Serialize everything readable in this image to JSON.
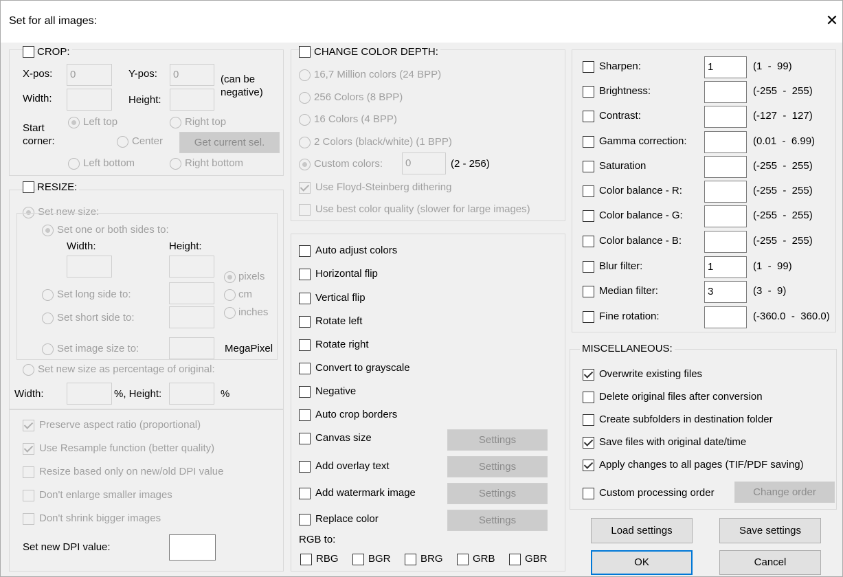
{
  "window": {
    "title": "Set for all images:",
    "close_symbol": "✕"
  },
  "crop": {
    "title": "CROP:",
    "xpos_label": "X-pos:",
    "xpos_value": "0",
    "ypos_label": "Y-pos:",
    "ypos_value": "0",
    "note": "(can be\nnegative)",
    "width_label": "Width:",
    "height_label": "Height:",
    "start_label": "Start\ncorner:",
    "left_top": "Left top",
    "right_top": "Right top",
    "center": "Center",
    "get_sel": "Get current sel.",
    "left_bottom": "Left bottom",
    "right_bottom": "Right bottom"
  },
  "resize": {
    "title": "RESIZE:",
    "set_new_size": "Set new size:",
    "set_one_both": "Set one or both sides to:",
    "width_label": "Width:",
    "height_label": "Height:",
    "pixels": "pixels",
    "cm": "cm",
    "inches": "inches",
    "set_long": "Set long side to:",
    "set_short": "Set short side to:",
    "set_image_size": "Set image size to:",
    "megapixel": "MegaPixel",
    "set_percentage": "Set new size as percentage of original:",
    "pct_width_label": "Width:",
    "pct_mid": "%, Height:",
    "pct_end": "%"
  },
  "options": {
    "preserve": "Preserve aspect ratio (proportional)",
    "resample": "Use Resample function (better quality)",
    "dpi_only": "Resize based only on new/old DPI value",
    "no_enlarge": "Don't enlarge smaller images",
    "no_shrink": "Don't shrink bigger images",
    "dpi_label": "Set new DPI value:"
  },
  "color_depth": {
    "title": "CHANGE COLOR DEPTH:",
    "c24": "16,7 Million colors (24 BPP)",
    "c8": "256 Colors (8 BPP)",
    "c4": "16 Colors (4 BPP)",
    "c1": "2 Colors (black/white) (1 BPP)",
    "custom": "Custom colors:",
    "custom_value": "0",
    "custom_range": "(2 - 256)",
    "floyd": "Use Floyd-Steinberg dithering",
    "best_quality": "Use best color quality (slower for large images)"
  },
  "transforms": {
    "auto_adjust": "Auto adjust colors",
    "hflip": "Horizontal flip",
    "vflip": "Vertical flip",
    "rot_left": "Rotate left",
    "rot_right": "Rotate right",
    "grayscale": "Convert to grayscale",
    "negative": "Negative",
    "auto_crop": "Auto crop borders",
    "canvas": "Canvas size",
    "overlay": "Add overlay text",
    "watermark": "Add watermark image",
    "replace": "Replace color",
    "settings": "Settings",
    "rgb_to": "RGB to:",
    "rbg": "RBG",
    "bgr": "BGR",
    "brg": "BRG",
    "grb": "GRB",
    "gbr": "GBR"
  },
  "filters": {
    "sharpen": "Sharpen:",
    "sharpen_value": "1",
    "sharpen_range": "(1  -  99)",
    "brightness": "Brightness:",
    "brightness_range": "(-255  -  255)",
    "contrast": "Contrast:",
    "contrast_range": "(-127  -  127)",
    "gamma": "Gamma correction:",
    "gamma_range": "(0.01  -  6.99)",
    "saturation": "Saturation",
    "saturation_range": "(-255  -  255)",
    "cb_r": "Color balance - R:",
    "cb_r_range": "(-255  -  255)",
    "cb_g": "Color balance - G:",
    "cb_g_range": "(-255  -  255)",
    "cb_b": "Color balance - B:",
    "cb_b_range": "(-255  -  255)",
    "blur": "Blur filter:",
    "blur_value": "1",
    "blur_range": "(1  -  99)",
    "median": "Median filter:",
    "median_value": "3",
    "median_range": "(3  -  9)",
    "fine_rot": "Fine rotation:",
    "fine_rot_range": "(-360.0  -  360.0)"
  },
  "misc": {
    "title": "MISCELLANEOUS:",
    "overwrite": "Overwrite existing files",
    "delete_orig": "Delete original files after conversion",
    "subfolders": "Create subfolders in destination folder",
    "orig_date": "Save files with original date/time",
    "all_pages": "Apply changes to all pages (TIF/PDF saving)",
    "custom_order": "Custom processing order",
    "change_order": "Change order"
  },
  "buttons": {
    "load": "Load settings",
    "save": "Save settings",
    "ok": "OK",
    "cancel": "Cancel"
  }
}
